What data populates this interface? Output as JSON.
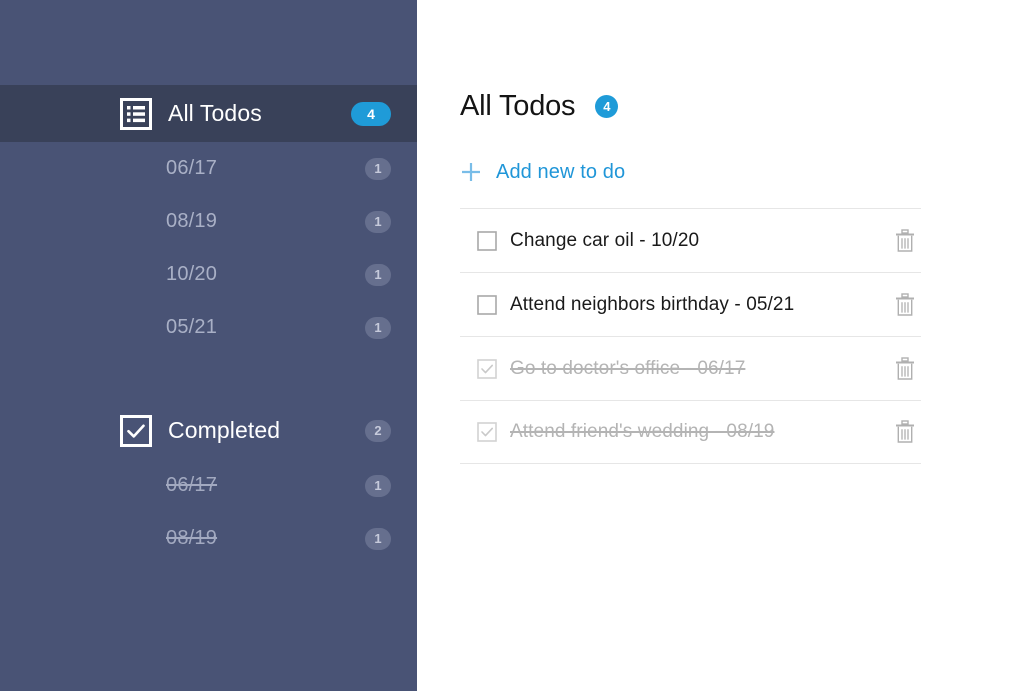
{
  "sidebar": {
    "groups": [
      {
        "icon": "list-icon",
        "label": "All Todos",
        "count": "4",
        "active": true,
        "items": [
          {
            "label": "06/17",
            "count": "1",
            "completed": false
          },
          {
            "label": "08/19",
            "count": "1",
            "completed": false
          },
          {
            "label": "10/20",
            "count": "1",
            "completed": false
          },
          {
            "label": "05/21",
            "count": "1",
            "completed": false
          }
        ]
      },
      {
        "icon": "checkbox-checked-icon",
        "label": "Completed",
        "count": "2",
        "active": false,
        "items": [
          {
            "label": "06/17",
            "count": "1",
            "completed": true
          },
          {
            "label": "08/19",
            "count": "1",
            "completed": true
          }
        ]
      }
    ]
  },
  "main": {
    "title": "All Todos",
    "count": "4",
    "add_label": "Add new to do",
    "add_icon": "plus-icon",
    "delete_icon": "trash-icon",
    "todos": [
      {
        "text": "Change car oil - 10/20",
        "completed": false
      },
      {
        "text": "Attend neighbors birthday - 05/21",
        "completed": false
      },
      {
        "text": "Go to doctor's office - 06/17",
        "completed": true
      },
      {
        "text": "Attend friend's wedding - 08/19",
        "completed": true
      }
    ]
  },
  "colors": {
    "sidebar_bg": "#495375",
    "sidebar_active_bg": "#394159",
    "accent_blue": "#1f9bd8",
    "link_blue": "#2096d8",
    "completed_grey": "#b4b4b4"
  }
}
